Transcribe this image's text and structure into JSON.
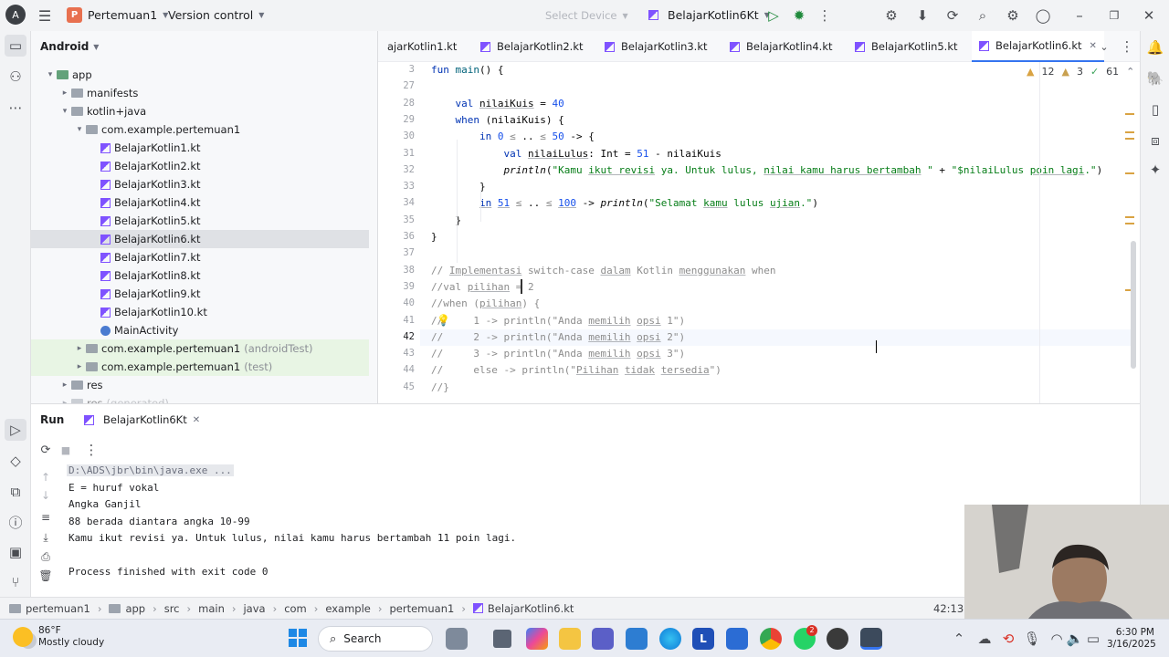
{
  "titlebar": {
    "project_initial": "P",
    "project_name": "Pertemuan1",
    "vcs": "Version control",
    "device": "Select Device",
    "run_config": "BelajarKotlin6Kt"
  },
  "project_panel": {
    "title": "Android",
    "tree": [
      {
        "label": "app",
        "kind": "module",
        "indent": 0,
        "arrow": "▾"
      },
      {
        "label": "manifests",
        "kind": "folder",
        "indent": 1,
        "arrow": "▸"
      },
      {
        "label": "kotlin+java",
        "kind": "folder",
        "indent": 1,
        "arrow": "▾"
      },
      {
        "label": "com.example.pertemuan1",
        "kind": "folder",
        "indent": 2,
        "arrow": "▾"
      },
      {
        "label": "BelajarKotlin1.kt",
        "kind": "kt",
        "indent": 3
      },
      {
        "label": "BelajarKotlin2.kt",
        "kind": "kt",
        "indent": 3
      },
      {
        "label": "BelajarKotlin3.kt",
        "kind": "kt",
        "indent": 3
      },
      {
        "label": "BelajarKotlin4.kt",
        "kind": "kt",
        "indent": 3
      },
      {
        "label": "BelajarKotlin5.kt",
        "kind": "kt",
        "indent": 3
      },
      {
        "label": "BelajarKotlin6.kt",
        "kind": "kt",
        "indent": 3,
        "selected": true
      },
      {
        "label": "BelajarKotlin7.kt",
        "kind": "kt",
        "indent": 3
      },
      {
        "label": "BelajarKotlin8.kt",
        "kind": "kt",
        "indent": 3
      },
      {
        "label": "BelajarKotlin9.kt",
        "kind": "kt",
        "indent": 3
      },
      {
        "label": "BelajarKotlin10.kt",
        "kind": "kt",
        "indent": 3
      },
      {
        "label": "MainActivity",
        "kind": "class",
        "indent": 3
      },
      {
        "label": "com.example.pertemuan1",
        "suffix": "(androidTest)",
        "kind": "folder",
        "indent": 2,
        "arrow": "▸",
        "green": true
      },
      {
        "label": "com.example.pertemuan1",
        "suffix": "(test)",
        "kind": "folder",
        "indent": 2,
        "arrow": "▸",
        "green": true
      },
      {
        "label": "res",
        "kind": "folder",
        "indent": 1,
        "arrow": "▸"
      },
      {
        "label": "res",
        "suffix": "(generated)",
        "kind": "folder",
        "indent": 1,
        "arrow": "▸"
      }
    ]
  },
  "tabs": [
    "ajarKotlin1.kt",
    "BelajarKotlin2.kt",
    "BelajarKotlin3.kt",
    "BelajarKotlin4.kt",
    "BelajarKotlin5.kt",
    "BelajarKotlin6.kt"
  ],
  "active_tab": 5,
  "inspections": {
    "warnings": "12",
    "weak": "3",
    "typos": "61"
  },
  "code_lines": [
    {
      "n": "3",
      "html": "<span class=\"kw\">fun</span> <span class=\"fn\">main</span>() {"
    },
    {
      "n": "27",
      "html": ""
    },
    {
      "n": "28",
      "html": "    <span class=\"kw\">val</span> <span class=\"ul\">nilaiKuis</span> = <span class=\"num\">40</span>"
    },
    {
      "n": "29",
      "html": "    <span class=\"kw\">when</span> (nilaiKuis) {"
    },
    {
      "n": "30",
      "html": "        <span class=\"kw\">in</span> <span class=\"num\">0</span> <span class=\"cm\">≤</span> .. <span class=\"cm\">≤</span> <span class=\"num\">50</span> -> {"
    },
    {
      "n": "31",
      "html": "            <span class=\"kw\">val</span> <span class=\"ul\">nilaiLulus</span>: Int = <span class=\"num\">51</span> - nilaiKuis"
    },
    {
      "n": "32",
      "html": "            <span class=\"it\">println</span>(<span class=\"str\">\"Kamu <span class=\"ul\">ikut revisi</span> ya. Untuk lulus, <span class=\"ul\">nilai kamu harus bertambah</span> \"</span> + <span class=\"str\">\"$nilaiLulus <span class=\"ul\">poin lagi</span>.\"</span>)"
    },
    {
      "n": "33",
      "html": "        }"
    },
    {
      "n": "34",
      "html": "        <span class=\"kw ul\">in</span> <span class=\"num ul\">51</span> <span class=\"cm\">≤</span> .. <span class=\"cm\">≤</span> <span class=\"num ul\">100</span> -> <span class=\"it\">println</span>(<span class=\"str\">\"Selamat <span class=\"ul\">kamu</span> lulus <span class=\"ul\">ujian</span>.\"</span>)"
    },
    {
      "n": "35",
      "html": "    }"
    },
    {
      "n": "36",
      "html": "}"
    },
    {
      "n": "37",
      "html": ""
    },
    {
      "n": "38",
      "html": "<span class=\"cm\">// <span class=\"ul\">Implementasi</span> switch-case <span class=\"ul\">dalam</span> Kotlin <span class=\"ul\">menggunakan</span> when</span>"
    },
    {
      "n": "39",
      "html": "<span class=\"cm\">//val <span class=\"ul\">pilihan</span> = 2</span>"
    },
    {
      "n": "40",
      "html": "<span class=\"cm\">//when (<span class=\"ul\">pilihan</span>) {</span>"
    },
    {
      "n": "41",
      "html": "<span class=\"cm\">//     1 -> println(\"Anda <span class=\"ul\">memilih</span> <span class=\"ul\">opsi</span> 1\")</span>"
    },
    {
      "n": "42",
      "html": "<span class=\"cm\">//     2 -> println(\"Anda <span class=\"ul\">memilih</span> <span class=\"ul\">opsi</span> 2\")</span>"
    },
    {
      "n": "43",
      "html": "<span class=\"cm\">//     3 -> println(\"Anda <span class=\"ul\">memilih</span> <span class=\"ul\">opsi</span> 3\")</span>"
    },
    {
      "n": "44",
      "html": "<span class=\"cm\">//     else -> println(\"<span class=\"ul\">Pilihan</span> <span class=\"ul\">tidak</span> <span class=\"ul\">tersedia</span>\")</span>"
    },
    {
      "n": "45",
      "html": "<span class=\"cm\">//}</span>"
    }
  ],
  "current_line": "42",
  "run_panel": {
    "title": "Run",
    "tab": "BelajarKotlin6Kt",
    "output": [
      "D:\\ADS\\jbr\\bin\\java.exe ...",
      "E = huruf vokal",
      "Angka Ganjil",
      "88 berada diantara angka 10-99",
      "Kamu ikut revisi ya. Untuk lulus, nilai kamu harus bertambah 11 poin lagi.",
      "",
      "Process finished with exit code 0"
    ]
  },
  "breadcrumbs": [
    "pertemuan1",
    "app",
    "src",
    "main",
    "java",
    "com",
    "example",
    "pertemuan1",
    "BelajarKotlin6.kt"
  ],
  "caret_position": "42:13",
  "taskbar": {
    "weather_temp": "86°F",
    "weather_desc": "Mostly cloudy",
    "search": "Search",
    "time": "6:30 PM",
    "date": "3/16/2025",
    "whatsapp_badge": "2"
  },
  "colors": {
    "accent": "#3574f0",
    "kotlin": "#7f52ff",
    "project_badge": "#e8704f",
    "test_green": "#e8f5e4"
  }
}
